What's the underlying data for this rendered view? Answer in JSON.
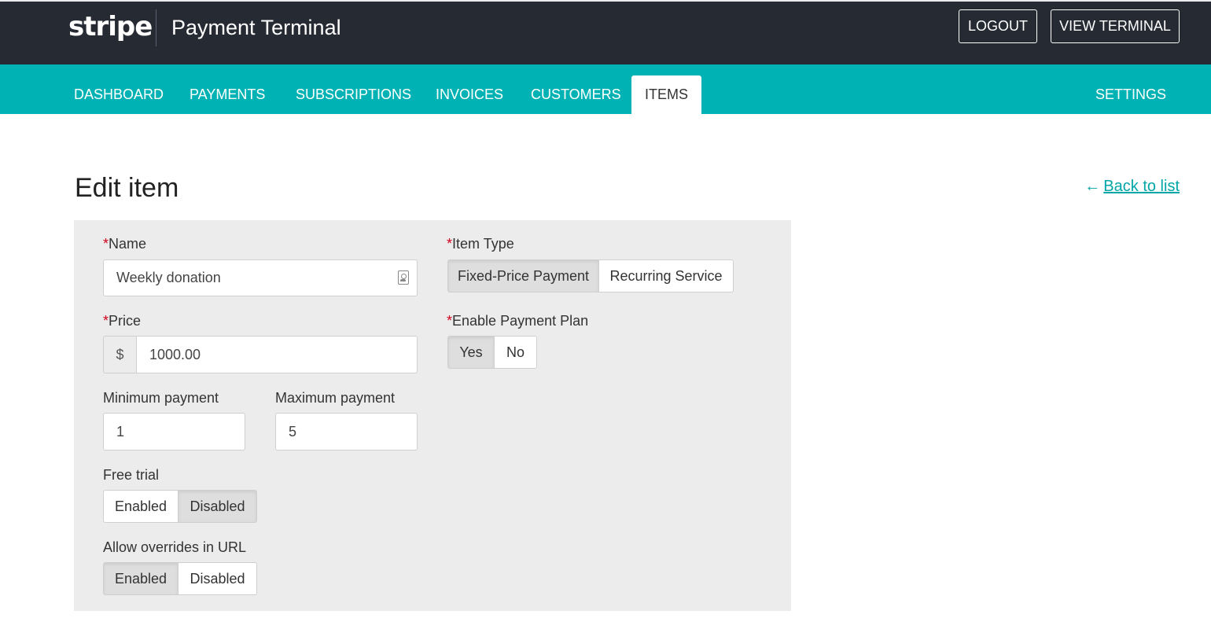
{
  "header": {
    "logo_text": "stripe",
    "app_title": "Payment Terminal",
    "logout_label": "LOGOUT",
    "view_terminal_label": "VIEW TERMINAL"
  },
  "nav": {
    "items": [
      {
        "label": "DASHBOARD"
      },
      {
        "label": "PAYMENTS"
      },
      {
        "label": "SUBSCRIPTIONS"
      },
      {
        "label": "INVOICES"
      },
      {
        "label": "CUSTOMERS"
      },
      {
        "label": "ITEMS",
        "active": true
      },
      {
        "label": "SETTINGS"
      }
    ]
  },
  "page": {
    "title": "Edit item",
    "back_arrow": "←",
    "back_label": "Back to list"
  },
  "form": {
    "required_mark": "*",
    "name": {
      "label": "Name",
      "value": "Weekly donation"
    },
    "price": {
      "label": "Price",
      "currency": "$",
      "value": "1000.00"
    },
    "min_payment": {
      "label": "Minimum payment",
      "value": "1"
    },
    "max_payment": {
      "label": "Maximum payment",
      "value": "5"
    },
    "free_trial": {
      "label": "Free trial",
      "options": [
        "Enabled",
        "Disabled"
      ],
      "selected": "Disabled"
    },
    "allow_overrides": {
      "label": "Allow overrides in URL",
      "options": [
        "Enabled",
        "Disabled"
      ],
      "selected": "Enabled"
    },
    "item_type": {
      "label": "Item Type",
      "options": [
        "Fixed-Price Payment",
        "Recurring Service"
      ],
      "selected": "Fixed-Price Payment"
    },
    "payment_plan": {
      "label": "Enable Payment Plan",
      "options": [
        "Yes",
        "No"
      ],
      "selected": "Yes"
    }
  },
  "colors": {
    "topbar": "#262a33",
    "navbar": "#00b2b3",
    "link": "#00a6a8",
    "required": "#d0021b",
    "panel": "#ececec"
  }
}
